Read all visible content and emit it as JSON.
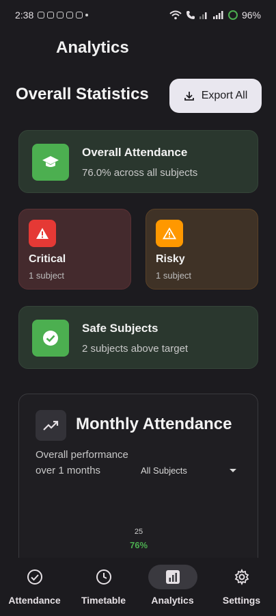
{
  "status_bar": {
    "time": "2:38",
    "battery": "96%"
  },
  "app": {
    "title": "Analytics"
  },
  "stats": {
    "section_title": "Overall Statistics",
    "export_label": "Export All",
    "overall": {
      "title": "Overall Attendance",
      "subtitle": "76.0% across all subjects"
    },
    "critical": {
      "title": "Critical",
      "subtitle": "1 subject"
    },
    "risky": {
      "title": "Risky",
      "subtitle": "1 subject"
    },
    "safe": {
      "title": "Safe Subjects",
      "subtitle": "2 subjects above target"
    }
  },
  "monthly": {
    "title": "Monthly Attendance",
    "description": "Overall performance over 1 months",
    "filter_selected": "All Subjects",
    "bar_count": "25",
    "bar_percent": "76%"
  },
  "nav": {
    "items": [
      {
        "label": "Attendance",
        "icon": "check-circle-icon"
      },
      {
        "label": "Timetable",
        "icon": "clock-icon"
      },
      {
        "label": "Analytics",
        "icon": "bar-chart-icon"
      },
      {
        "label": "Settings",
        "icon": "gear-icon"
      }
    ]
  },
  "colors": {
    "background": "#1c1b1f",
    "accent_green": "#4caf50",
    "critical_red": "#e53935",
    "risky_orange": "#ff9800"
  }
}
